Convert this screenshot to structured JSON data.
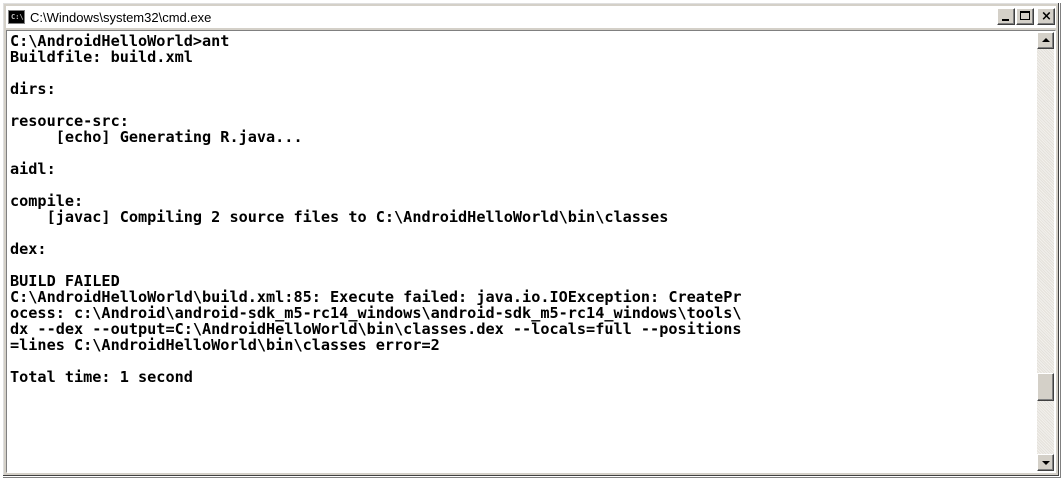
{
  "window": {
    "title": "C:\\Windows\\system32\\cmd.exe",
    "icon": "console-icon",
    "icon_text": "C:\\"
  },
  "caption_buttons": {
    "minimize": "minimize-icon",
    "maximize": "maximize-icon",
    "close": "×"
  },
  "console": {
    "lines": [
      "C:\\AndroidHelloWorld>ant",
      "Buildfile: build.xml",
      "",
      "dirs:",
      "",
      "resource-src:",
      "     [echo] Generating R.java...",
      "",
      "aidl:",
      "",
      "compile:",
      "    [javac] Compiling 2 source files to C:\\AndroidHelloWorld\\bin\\classes",
      "",
      "dex:",
      "",
      "BUILD FAILED",
      "C:\\AndroidHelloWorld\\build.xml:85: Execute failed: java.io.IOException: CreatePr",
      "ocess: c:\\Android\\android-sdk_m5-rc14_windows\\android-sdk_m5-rc14_windows\\tools\\",
      "dx --dex --output=C:\\AndroidHelloWorld\\bin\\classes.dex --locals=full --positions",
      "=lines C:\\AndroidHelloWorld\\bin\\classes error=2",
      "",
      "Total time: 1 second"
    ]
  },
  "scrollbar": {
    "up_icon": "arrow-up-icon",
    "down_icon": "arrow-down-icon",
    "scroll_position": 0.86
  }
}
